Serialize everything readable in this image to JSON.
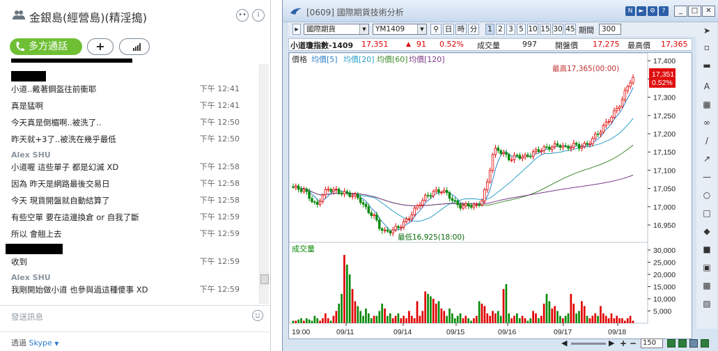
{
  "skype": {
    "title": "金銀島(經營島)(精淫搗)",
    "call_label": "多方通話",
    "add_label": "+",
    "messages": [
      {
        "text": "小道..戴著鋼盔往前衝耶",
        "time": "下午 12:41"
      },
      {
        "text": "真是猛啊",
        "time": "下午 12:41"
      },
      {
        "text": "今天真是倒楣啊..被洗了..",
        "time": "下午 12:50"
      },
      {
        "text": "昨天就+3了..被洗在幾乎最低",
        "time": "下午 12:50"
      },
      {
        "sender": "Alex SHU"
      },
      {
        "text": "小道喔 這些單子 都是幻滅 XD",
        "time": "下午 12:58"
      },
      {
        "text": "因為 昨天是網路最後交易日",
        "time": "下午 12:58"
      },
      {
        "text": "今天 現貨開盤就自動結算了",
        "time": "下午 12:58"
      },
      {
        "text": "有些空單 要在這邊換倉 or 自我了斷",
        "time": "下午 12:59"
      },
      {
        "text": "所以 會翹上去",
        "time": "下午 12:59"
      },
      {
        "text": "收到",
        "time": "下午 12:59"
      },
      {
        "sender": "Alex SHU"
      },
      {
        "text": "我剛開始做小道 也參與過這種傻事 XD",
        "time": "下午 12:59"
      }
    ],
    "input_placeholder": "發送訊息",
    "footer_prefix": "透過",
    "footer_link": "Skype"
  },
  "trade": {
    "window_title": "[0609] 國際期貨技術分析",
    "market_select": "國際期貨",
    "symbol_select": "YM1409",
    "btn_day": "日",
    "btn_hour": "時",
    "btn_min": "分",
    "interval_buttons": [
      "1",
      "2",
      "3",
      "5",
      "10",
      "15",
      "30",
      "45"
    ],
    "period_label": "期間",
    "period_value": "300",
    "quote": {
      "name": "小道瓊指數-1409",
      "price": "17,351",
      "change": "91",
      "pct": "0.52%",
      "vol_label": "成交量",
      "vol": "997",
      "open_label": "開盤價",
      "open": "17,275",
      "high_label": "最高價",
      "high": "17,365"
    },
    "legend": {
      "price": "價格",
      "ma5": "均價[5]",
      "ma20": "均價[20]",
      "ma60": "均價[60]",
      "ma120": "均價[120]"
    },
    "high_note": "最高17,365(00:00)",
    "low_note": "最低16,925(18:00)",
    "last_price_tag": "17,351",
    "last_pct_tag": "0.52%",
    "volume_label": "成交量",
    "zoom_value": "150",
    "colors": {
      "up": "#e00000",
      "down": "#0a8a0a",
      "ma5": "#2a7fc9",
      "ma20": "#2aa0c9",
      "ma60": "#3c8a2a",
      "ma120": "#7a3a8a"
    }
  },
  "chart_data": {
    "type": "candlestick",
    "price_ticks": [
      "17,400",
      "17,350",
      "17,300",
      "17,250",
      "17,200",
      "17,150",
      "17,100",
      "17,050",
      "17,000",
      "16,950"
    ],
    "volume_ticks": [
      "30,000",
      "25,000",
      "20,000",
      "15,000",
      "10,000",
      "5,000"
    ],
    "x_labels": [
      "19:00",
      "09/11",
      "09/14",
      "09/15",
      "09/16",
      "09/17",
      "09/18"
    ],
    "ylim": [
      16910,
      17410
    ],
    "vol_ylim": [
      0,
      32000
    ],
    "price_path": [
      [
        0,
        17055
      ],
      [
        10,
        17050
      ],
      [
        20,
        17045
      ],
      [
        30,
        17020
      ],
      [
        38,
        17000
      ],
      [
        45,
        17030
      ],
      [
        55,
        17050
      ],
      [
        62,
        17045
      ],
      [
        72,
        17040
      ],
      [
        82,
        17035
      ],
      [
        92,
        17030
      ],
      [
        100,
        17020
      ],
      [
        110,
        16990
      ],
      [
        120,
        16975
      ],
      [
        128,
        16945
      ],
      [
        136,
        16930
      ],
      [
        146,
        16935
      ],
      [
        156,
        16945
      ],
      [
        166,
        16960
      ],
      [
        176,
        16985
      ],
      [
        186,
        17010
      ],
      [
        196,
        17030
      ],
      [
        206,
        17040
      ],
      [
        216,
        17045
      ],
      [
        226,
        17035
      ],
      [
        236,
        17010
      ],
      [
        246,
        17000
      ],
      [
        256,
        17005
      ],
      [
        266,
        17000
      ],
      [
        276,
        17020
      ],
      [
        284,
        17075
      ],
      [
        290,
        17140
      ],
      [
        296,
        17160
      ],
      [
        306,
        17145
      ],
      [
        316,
        17130
      ],
      [
        326,
        17140
      ],
      [
        336,
        17135
      ],
      [
        346,
        17145
      ],
      [
        356,
        17155
      ],
      [
        366,
        17160
      ],
      [
        376,
        17165
      ],
      [
        386,
        17170
      ],
      [
        396,
        17160
      ],
      [
        406,
        17170
      ],
      [
        416,
        17165
      ],
      [
        426,
        17170
      ],
      [
        436,
        17190
      ],
      [
        446,
        17210
      ],
      [
        456,
        17235
      ],
      [
        466,
        17260
      ],
      [
        476,
        17290
      ],
      [
        484,
        17330
      ],
      [
        490,
        17351
      ]
    ],
    "volumes": [
      1,
      1,
      1.5,
      2,
      1,
      2,
      1.5,
      1,
      3,
      2,
      1,
      2,
      4,
      2,
      1,
      3,
      5,
      8,
      12,
      28,
      24,
      20,
      14,
      9,
      7,
      5,
      3,
      6,
      4,
      2,
      3,
      3,
      5,
      8,
      6,
      3,
      4,
      2,
      3,
      4,
      2,
      3,
      2,
      5,
      3,
      2,
      9,
      3,
      5,
      13,
      12,
      11,
      10,
      8,
      9,
      6,
      5,
      3,
      6,
      4,
      2,
      3,
      4,
      2,
      3,
      2,
      1,
      2,
      3,
      9,
      8,
      7,
      4,
      3,
      5,
      4,
      5,
      3,
      14,
      16,
      4,
      2,
      3,
      4,
      2,
      3,
      2,
      1,
      2,
      5,
      4,
      2,
      3,
      8,
      12,
      9,
      6,
      7,
      5,
      3,
      2,
      3,
      4,
      12,
      8,
      4,
      5,
      9,
      7,
      3,
      2,
      3,
      4,
      3,
      7,
      4,
      3,
      2,
      4,
      2,
      3,
      2,
      2,
      1,
      2,
      3,
      1
    ]
  }
}
